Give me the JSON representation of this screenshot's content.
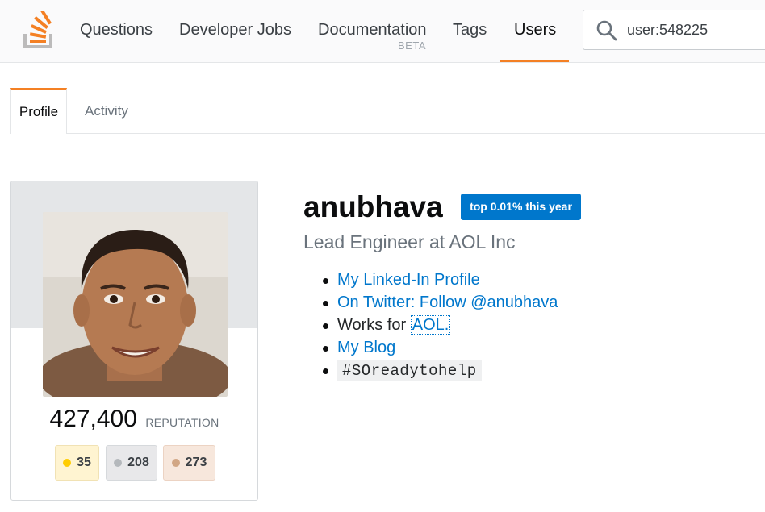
{
  "nav": {
    "items": [
      {
        "label": "Questions"
      },
      {
        "label": "Developer Jobs"
      },
      {
        "label": "Documentation",
        "sublabel": "BETA"
      },
      {
        "label": "Tags"
      },
      {
        "label": "Users",
        "active": true
      }
    ],
    "search": {
      "value": "user:548225",
      "icon": "search-icon"
    },
    "logo_icon": "stack-overflow-logo"
  },
  "tabs": [
    {
      "label": "Profile",
      "active": true
    },
    {
      "label": "Activity"
    }
  ],
  "profile": {
    "reputation": "427,400",
    "reputation_label": "REPUTATION",
    "badges": {
      "gold": "35",
      "silver": "208",
      "bronze": "273"
    },
    "name": "anubhava",
    "top_badge": "top 0.01% this year",
    "title": "Lead Engineer at AOL Inc",
    "about": {
      "linkedin": "My Linked-In Profile",
      "twitter": "On Twitter: Follow @anubhava",
      "works_prefix": "Works for ",
      "works_link": "AOL.",
      "blog": "My Blog",
      "hashtag": "#SOreadytohelp"
    }
  },
  "colors": {
    "accent": "#f48024",
    "link": "#0077cc",
    "gold": "#ffcc01",
    "silver": "#b4b8bc",
    "bronze": "#d1a684"
  }
}
